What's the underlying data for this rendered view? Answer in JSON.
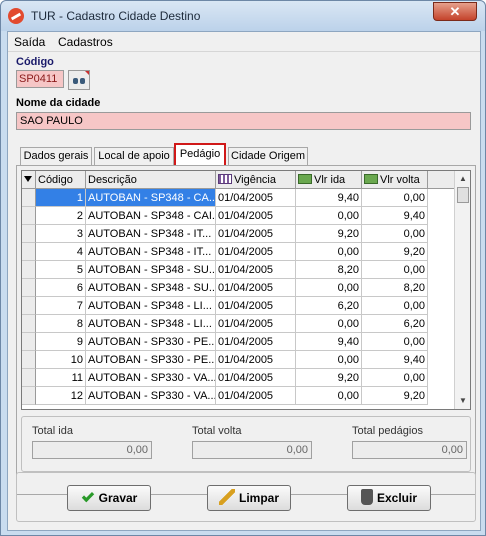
{
  "window": {
    "title": "TUR - Cadastro Cidade Destino",
    "close_label": "✕"
  },
  "menu": {
    "items": [
      "Saída",
      "Cadastros"
    ]
  },
  "form": {
    "codigo_label": "Código",
    "codigo_value": "SP0411",
    "nome_label": "Nome da cidade",
    "nome_value": "SAO PAULO"
  },
  "tabs": [
    "Dados gerais",
    "Local de apoio",
    "Pedágio",
    "Cidade Origem"
  ],
  "grid": {
    "columns": [
      "Código",
      "Descrição",
      "Vigência",
      "Vlr ida",
      "Vlr volta"
    ],
    "rows": [
      [
        "1",
        "AUTOBAN - SP348 - CA...",
        "01/04/2005",
        "9,40",
        "0,00"
      ],
      [
        "2",
        "AUTOBAN - SP348 - CAI...",
        "01/04/2005",
        "0,00",
        "9,40"
      ],
      [
        "3",
        "AUTOBAN - SP348 - IT...",
        "01/04/2005",
        "9,20",
        "0,00"
      ],
      [
        "4",
        "AUTOBAN - SP348 - IT...",
        "01/04/2005",
        "0,00",
        "9,20"
      ],
      [
        "5",
        "AUTOBAN - SP348 - SU...",
        "01/04/2005",
        "8,20",
        "0,00"
      ],
      [
        "6",
        "AUTOBAN - SP348 - SU...",
        "01/04/2005",
        "0,00",
        "8,20"
      ],
      [
        "7",
        "AUTOBAN - SP348 - LI...",
        "01/04/2005",
        "6,20",
        "0,00"
      ],
      [
        "8",
        "AUTOBAN - SP348 - LI...",
        "01/04/2005",
        "0,00",
        "6,20"
      ],
      [
        "9",
        "AUTOBAN - SP330 - PE...",
        "01/04/2005",
        "9,40",
        "0,00"
      ],
      [
        "10",
        "AUTOBAN - SP330 - PE...",
        "01/04/2005",
        "0,00",
        "9,40"
      ],
      [
        "11",
        "AUTOBAN - SP330 - VA...",
        "01/04/2005",
        "9,20",
        "0,00"
      ],
      [
        "12",
        "AUTOBAN - SP330 - VA...",
        "01/04/2005",
        "0,00",
        "9,20"
      ]
    ]
  },
  "totals": {
    "ida_label": "Total ida",
    "ida_value": "0,00",
    "volta_label": "Total volta",
    "volta_value": "0,00",
    "pedagios_label": "Total pedágios",
    "pedagios_value": "0,00"
  },
  "buttons": {
    "gravar": "Gravar",
    "limpar": "Limpar",
    "excluir": "Excluir"
  }
}
